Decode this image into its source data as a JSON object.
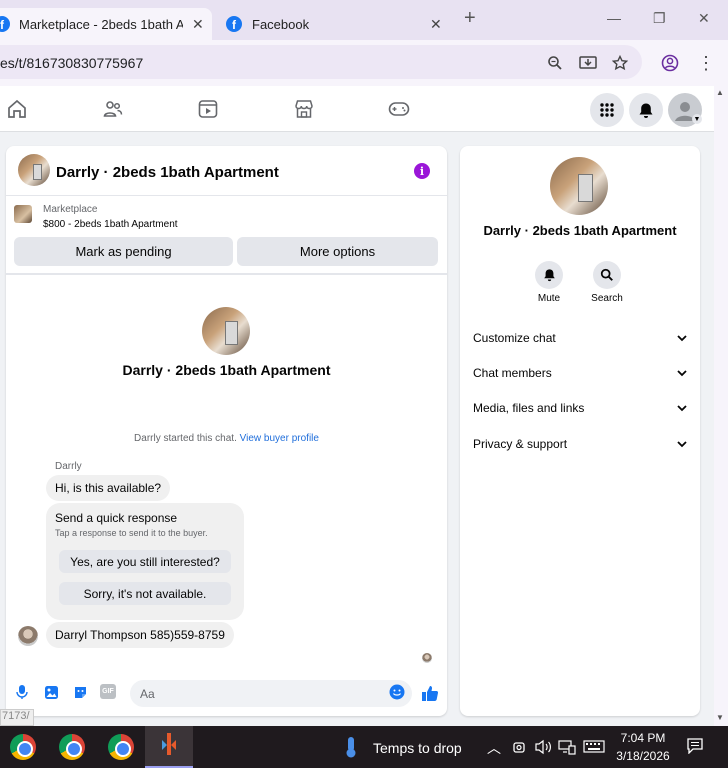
{
  "browser": {
    "tabs": [
      {
        "title": "Marketplace - 2beds 1bath Apa",
        "close": "✕"
      },
      {
        "title": "Facebook",
        "close": "✕"
      }
    ],
    "new_tab": "+",
    "url": "es/t/816730830775967"
  },
  "conversation": {
    "title": "Darrly · 2beds 1bath Apartment",
    "listing": {
      "source": "Marketplace",
      "price_title": "$800 - 2beds 1bath Apartment"
    },
    "buttons": {
      "mark_pending": "Mark as pending",
      "more_options": "More options"
    },
    "center_title": "Darrly · 2beds 1bath Apartment",
    "started_text": "Darrly started this chat.",
    "view_profile": "View buyer profile",
    "sender_name": "Darrly",
    "messages": [
      {
        "text": "Hi, is this available?"
      },
      {
        "text": "Darryl Thompson 585)559-8759"
      }
    ],
    "quick_response": {
      "title": "Send a quick response",
      "subtitle": "Tap a response to send it to the buyer.",
      "options": [
        "Yes, are you still interested?",
        "Sorry, it's not available."
      ]
    },
    "composer_placeholder": "Aa",
    "gif_label": "GIF"
  },
  "side_panel": {
    "title": "Darrly · 2beds 1bath Apartment",
    "actions": [
      {
        "label": "Mute",
        "icon": "bell-icon"
      },
      {
        "label": "Search",
        "icon": "search-icon"
      }
    ],
    "sections": [
      "Customize chat",
      "Chat members",
      "Media, files and links",
      "Privacy & support"
    ]
  },
  "status_hint": "7173/",
  "taskbar": {
    "weather": "Temps to drop",
    "time": "7:04 PM",
    "date": "3/18/2026"
  },
  "colors": {
    "accent": "#1877f2",
    "info": "#9a16d8",
    "link": "#216fdb"
  }
}
